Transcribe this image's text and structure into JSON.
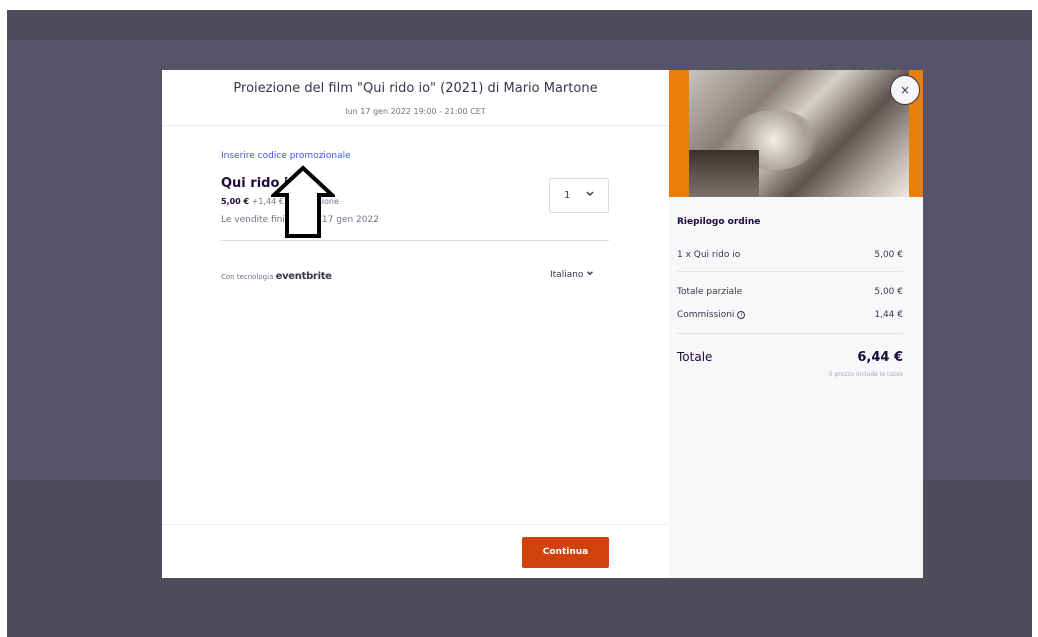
{
  "event": {
    "title": "Proiezione del film \"Qui rido io\" (2021) di Mario Martone",
    "datetime": "lun 17 gen 2022 19:00 - 21:00 CET"
  },
  "promo_link": "Inserire codice promozionale",
  "ticket": {
    "name": "Qui rido io",
    "price": "5,00 €",
    "fee": "+1,44 € commissione",
    "sales_end": "Le vendite finiscono il 17 gen 2022",
    "quantity": "1"
  },
  "footer_left": {
    "powered_prefix": "Con tecnologia",
    "powered_brand": "eventbrite",
    "language": "Italiano"
  },
  "continue_label": "Continua",
  "summary": {
    "heading": "Riepilogo ordine",
    "line_item_label": "1 x Qui rido io",
    "line_item_value": "5,00 €",
    "subtotal_label": "Totale parziale",
    "subtotal_value": "5,00 €",
    "fees_label": "Commissioni",
    "fees_value": "1,44 €",
    "total_label": "Totale",
    "total_value": "6,44 €",
    "tax_note": "Il prezzo include le tasse"
  },
  "close_symbol": "×",
  "colors": {
    "accent_button": "#d1410c",
    "link": "#3659e3",
    "image_border": "#e87e0c",
    "backdrop": "#4f4c5b"
  },
  "icons": [
    "chevron-down-icon",
    "info-icon",
    "close-icon",
    "up-arrow-annotation-icon"
  ]
}
